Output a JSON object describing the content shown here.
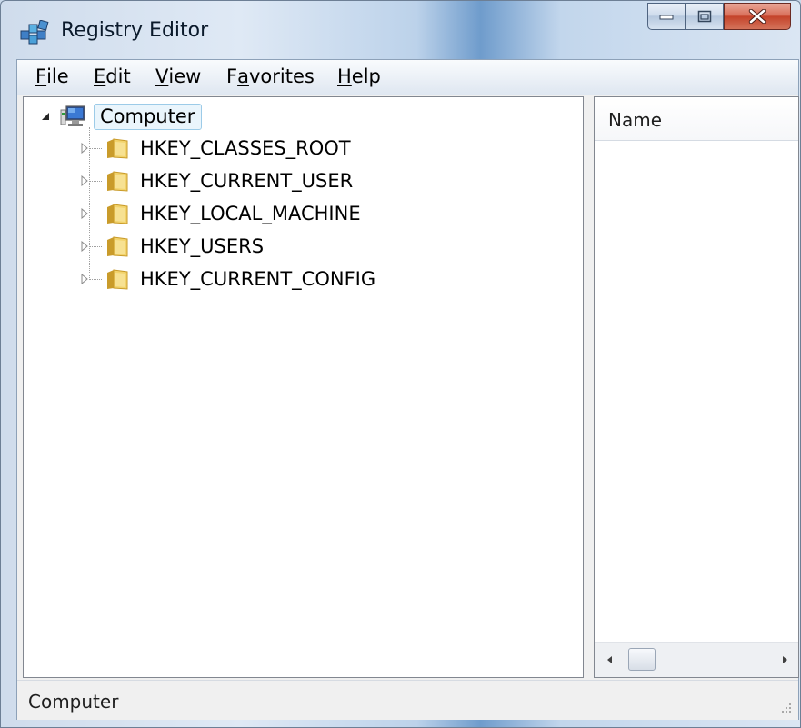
{
  "window": {
    "title": "Registry Editor",
    "icon": "registry-editor-icon",
    "controls": [
      "minimize-icon",
      "maximize-icon",
      "close-icon"
    ]
  },
  "menu": {
    "items": [
      {
        "label": "File",
        "accel": "F",
        "rest": "ile"
      },
      {
        "label": "Edit",
        "accel": "E",
        "rest": "dit"
      },
      {
        "label": "View",
        "accel": "V",
        "rest": "iew"
      },
      {
        "label": "Favorites",
        "pre": "F",
        "accel": "a",
        "rest": "vorites"
      },
      {
        "label": "Help",
        "accel": "H",
        "rest": "elp"
      }
    ]
  },
  "tree": {
    "root": {
      "label": "Computer",
      "icon": "computer-icon",
      "expanded": true,
      "selected": true
    },
    "keys": [
      {
        "label": "HKEY_CLASSES_ROOT",
        "icon": "folder-icon",
        "expanded": false
      },
      {
        "label": "HKEY_CURRENT_USER",
        "icon": "folder-icon",
        "expanded": false
      },
      {
        "label": "HKEY_LOCAL_MACHINE",
        "icon": "folder-icon",
        "expanded": false
      },
      {
        "label": "HKEY_USERS",
        "icon": "folder-icon",
        "expanded": false
      },
      {
        "label": "HKEY_CURRENT_CONFIG",
        "icon": "folder-icon",
        "expanded": false
      }
    ]
  },
  "list": {
    "columns": [
      "Name"
    ]
  },
  "status": {
    "text": "Computer"
  },
  "colors": {
    "close_button": "#c4432a",
    "selection_border": "#9ccbe8",
    "folder": "#e9c24e"
  }
}
